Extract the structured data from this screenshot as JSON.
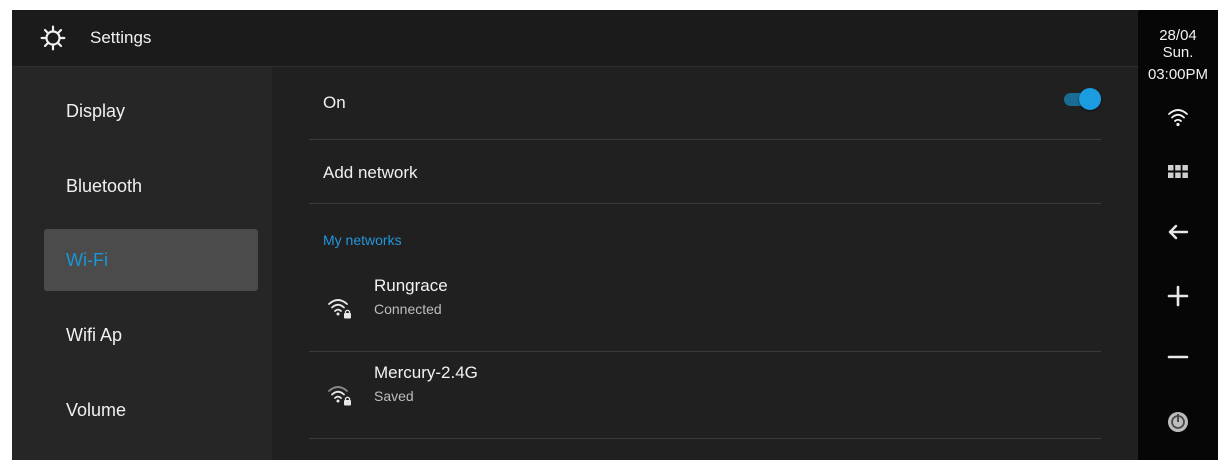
{
  "header": {
    "title": "Settings",
    "icon": "gear-icon"
  },
  "sidebar": {
    "items": [
      {
        "label": "Display",
        "active": false
      },
      {
        "label": "Bluetooth",
        "active": false
      },
      {
        "label": "Wi-Fi",
        "active": true
      },
      {
        "label": "Wifi Ap",
        "active": false
      },
      {
        "label": "Volume",
        "active": false
      }
    ]
  },
  "main": {
    "wifi_toggle": {
      "label": "On",
      "enabled": true
    },
    "add_network": {
      "label": "Add network"
    },
    "section_label": "My networks",
    "networks": [
      {
        "name": "Rungrace",
        "status": "Connected",
        "icon": "wifi-lock-icon"
      },
      {
        "name": "Mercury-2.4G",
        "status": "Saved",
        "icon": "wifi-lock-icon"
      }
    ]
  },
  "status_bar": {
    "date": "28/04",
    "day": "Sun.",
    "time": "03:00PM",
    "icons": [
      "wifi-icon",
      "apps-grid-icon",
      "back-arrow-icon",
      "volume-up-icon",
      "volume-down-icon",
      "power-icon"
    ]
  },
  "colors": {
    "accent": "#1a95d6",
    "background": "#202020",
    "sidebar": "#262626",
    "active_item": "#4b4b4b",
    "status_bar": "#060606"
  }
}
